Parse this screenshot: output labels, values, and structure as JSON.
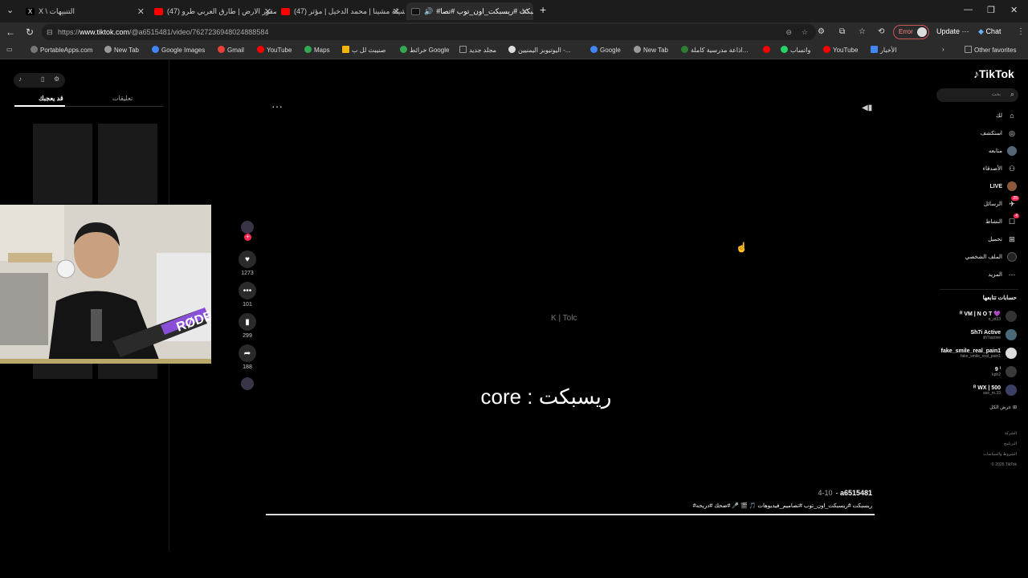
{
  "browser": {
    "tabs": [
      {
        "label": "X \\ التنبيهات",
        "favicon_color": "#000000",
        "active": false
      },
      {
        "label": "(47) صقور الارض | طارق العربي طرو",
        "favicon_color": "#ff0000",
        "active": false
      },
      {
        "label": "(47) شيلة مشينا | محمد الدخيل | مؤثر",
        "favicon_color": "#ff0000",
        "active": false
      },
      {
        "label": "#ريسبكت #ريسبكت_اون_توب #تصا",
        "favicon_color": "#111111",
        "active": true
      }
    ],
    "new_tab_label": "+",
    "url_prefix": "https://",
    "url_host": "www.tiktok.com",
    "url_path": "/@a6515481/video/7627236948024888584",
    "error_label": "Error",
    "update_label": "Update",
    "chat_label": "Chat",
    "bookmarks": [
      {
        "label": "PortableApps.com",
        "color": "#777777"
      },
      {
        "label": "New Tab",
        "color": "#999999"
      },
      {
        "label": "Google Images",
        "color": "#4285f4"
      },
      {
        "label": "Gmail",
        "color": "#ea4335"
      },
      {
        "label": "YouTube",
        "color": "#ff0000"
      },
      {
        "label": "Maps",
        "color": "#34a853"
      },
      {
        "label": "صنيبث لل ب",
        "color": "#f4b400"
      },
      {
        "label": "خرائط Google",
        "color": "#34a853"
      },
      {
        "label": "مجلد جديد",
        "color": "#999999"
      },
      {
        "label": "اليوتيوبز اليمنيين -...",
        "color": "#dddddd"
      },
      {
        "label": "Google",
        "color": "#4285f4"
      },
      {
        "label": "New Tab",
        "color": "#999999"
      },
      {
        "label": "اذاعة مدرسية كاملة...",
        "color": "#2e7d32"
      },
      {
        "label": "واتساب",
        "color": "#25d366"
      },
      {
        "label": "YouTube",
        "color": "#ff0000"
      },
      {
        "label": "الأخبار",
        "color": "#4285f4"
      },
      {
        "label": "Other favorites",
        "color": "#999999"
      }
    ]
  },
  "left_panel": {
    "tab_comments": "تعليقات",
    "tab_you_may_like": "قد يعجبك"
  },
  "video": {
    "watermark": "K | Tolc",
    "caption": "core : ريسبكت",
    "more_label": "···",
    "username": "a6515481",
    "date": "4-10",
    "description": "#ريسبكت #ريسبكت_اون_توب #تصاميم_فيديوهات 🎵 🎬 🎤 #ضحك #دريحه",
    "stats": {
      "likes": "1273",
      "comments": "101",
      "saves": "299",
      "shares": "188"
    }
  },
  "sidebar": {
    "logo": "TikTok",
    "search_placeholder": "بحث",
    "nav": [
      {
        "label": "لك",
        "icon": "home-icon",
        "glyph": "⌂"
      },
      {
        "label": "استكشف",
        "icon": "compass-icon",
        "glyph": "◎"
      },
      {
        "label": "متابعه",
        "icon": "following-avatar-icon",
        "glyph": "●"
      },
      {
        "label": "الأصدقاء",
        "icon": "friends-icon",
        "glyph": "👥"
      },
      {
        "label": "LIVE",
        "icon": "live-icon",
        "glyph": "●"
      },
      {
        "label": "الرسائل",
        "icon": "messages-icon",
        "glyph": "✈",
        "badge": "25"
      },
      {
        "label": "النشاط",
        "icon": "activity-icon",
        "glyph": "☐",
        "badge": "4"
      },
      {
        "label": "تحميل",
        "icon": "upload-icon",
        "glyph": "⊞"
      },
      {
        "label": "الملف الشخصي",
        "icon": "profile-icon",
        "glyph": "◍"
      },
      {
        "label": "المزيد",
        "icon": "more-icon",
        "glyph": "···"
      }
    ],
    "following_title": "حسابات تتابعها",
    "accounts": [
      {
        "name": "ᴿ VM | N O T 💜",
        "handle": "n_ot33"
      },
      {
        "name": "Sh7i Active",
        "handle": "sh7iactive"
      },
      {
        "name": "fake_smile_real_pain1",
        "handle": "fake_smile_real_pain1"
      },
      {
        "name": "9 ⁱ",
        "handle": "kph2"
      },
      {
        "name": "ᴿ WX | 500",
        "handle": "see_m.33"
      }
    ],
    "see_all": "عرض الكل",
    "footer": [
      "الشركة",
      "البرنامج",
      "الشروط والسياسات",
      "© 2026 TikTok"
    ]
  }
}
